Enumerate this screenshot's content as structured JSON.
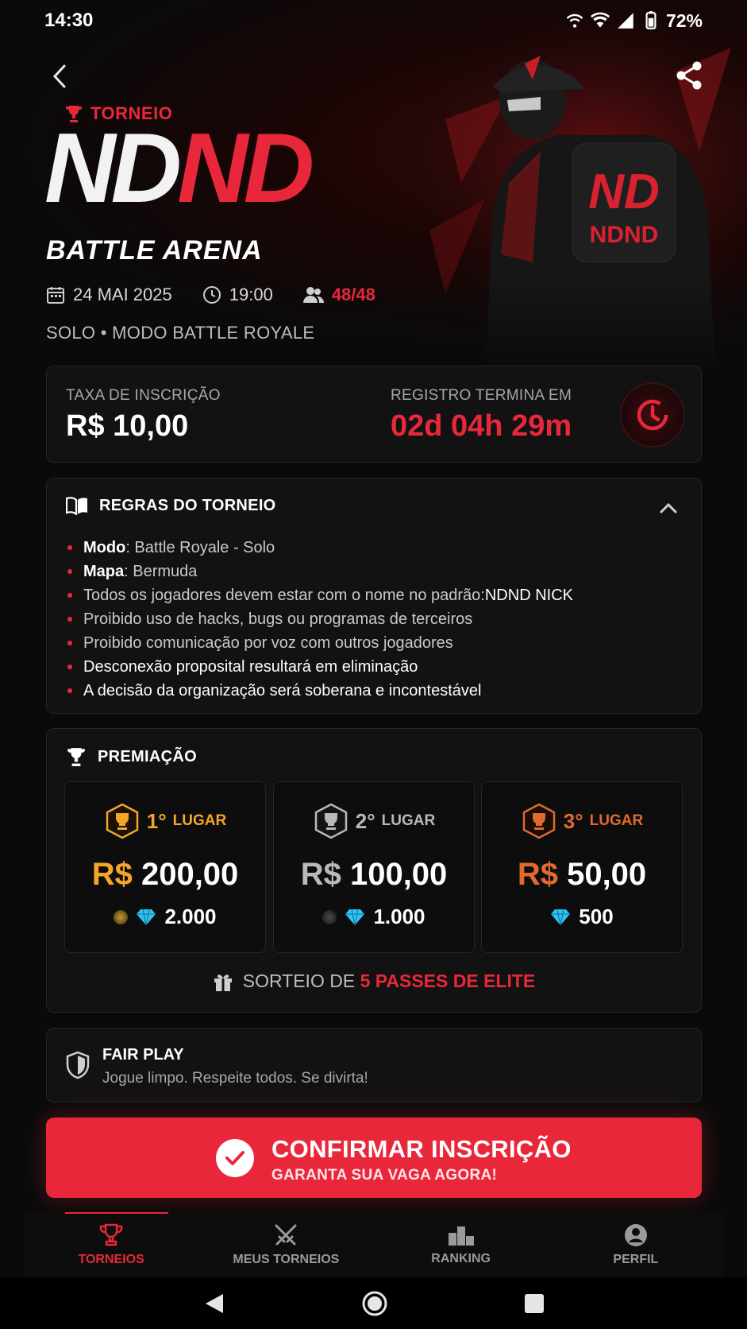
{
  "status_bar": {
    "time": "14:30",
    "battery": "72%"
  },
  "hero": {
    "tag": "TORNEIO",
    "title_white": "ND",
    "title_red": "ND",
    "subtitle": "BATTLE ARENA",
    "date": "24 MAI 2025",
    "time": "19:00",
    "players": "48/48",
    "mode_line": "SOLO • MODO BATTLE ROYALE",
    "backpack_logo_top": "ND",
    "backpack_logo_bottom": "NDND"
  },
  "fee": {
    "label": "TAXA DE INSCRIÇÃO",
    "value": "R$ 10,00",
    "deadline_label": "REGISTRO TERMINA EM",
    "deadline_value": "02d 04h 29m"
  },
  "rules": {
    "title": "REGRAS DO TORNEIO",
    "items": [
      {
        "bold": "Modo",
        "text": ": Battle Royale - Solo"
      },
      {
        "bold": "Mapa",
        "text": ": Bermuda"
      },
      {
        "text": "Todos os jogadores devem estar com o nome no padrão: ",
        "highlight": "NDND NICK"
      },
      {
        "text": "Proibido uso de hacks, bugs ou programas de terceiros"
      },
      {
        "text": "Proibido comunicação por voz com outros jogadores"
      },
      {
        "text": "Desconexão proposital resultará em eliminação"
      },
      {
        "text": "A decisão da organização será soberana e incontestável"
      }
    ]
  },
  "prizes": {
    "title": "PREMIAÇÃO",
    "places": [
      {
        "num": "1°",
        "label": "LUGAR",
        "currency": "R$",
        "amount": "200,00",
        "gems": "2.000",
        "color": "#f4a62a"
      },
      {
        "num": "2°",
        "label": "LUGAR",
        "currency": "R$",
        "amount": "100,00",
        "gems": "1.000",
        "color": "#b9b9b9"
      },
      {
        "num": "3°",
        "label": "LUGAR",
        "currency": "R$",
        "amount": "50,00",
        "gems": "500",
        "color": "#e06a2e"
      }
    ],
    "raffle_prefix": "SORTEIO DE ",
    "raffle_highlight": "5 PASSES DE ELITE"
  },
  "fair_play": {
    "title": "FAIR PLAY",
    "text": "Jogue limpo. Respeite todos. Se divirta!"
  },
  "cta": {
    "title": "CONFIRMAR INSCRIÇÃO",
    "subtitle": "GARANTA SUA VAGA AGORA!"
  },
  "nav": {
    "items": [
      {
        "label": "TORNEIOS",
        "icon": "trophy-icon",
        "active": true
      },
      {
        "label": "MEUS TORNEIOS",
        "icon": "crossed-swords-icon",
        "active": false
      },
      {
        "label": "RANKING",
        "icon": "podium-icon",
        "active": false
      },
      {
        "label": "PERFIL",
        "icon": "user-icon",
        "active": false
      }
    ]
  },
  "colors": {
    "accent": "#e8283a",
    "background": "#0a0a0a",
    "card": "#121212"
  }
}
